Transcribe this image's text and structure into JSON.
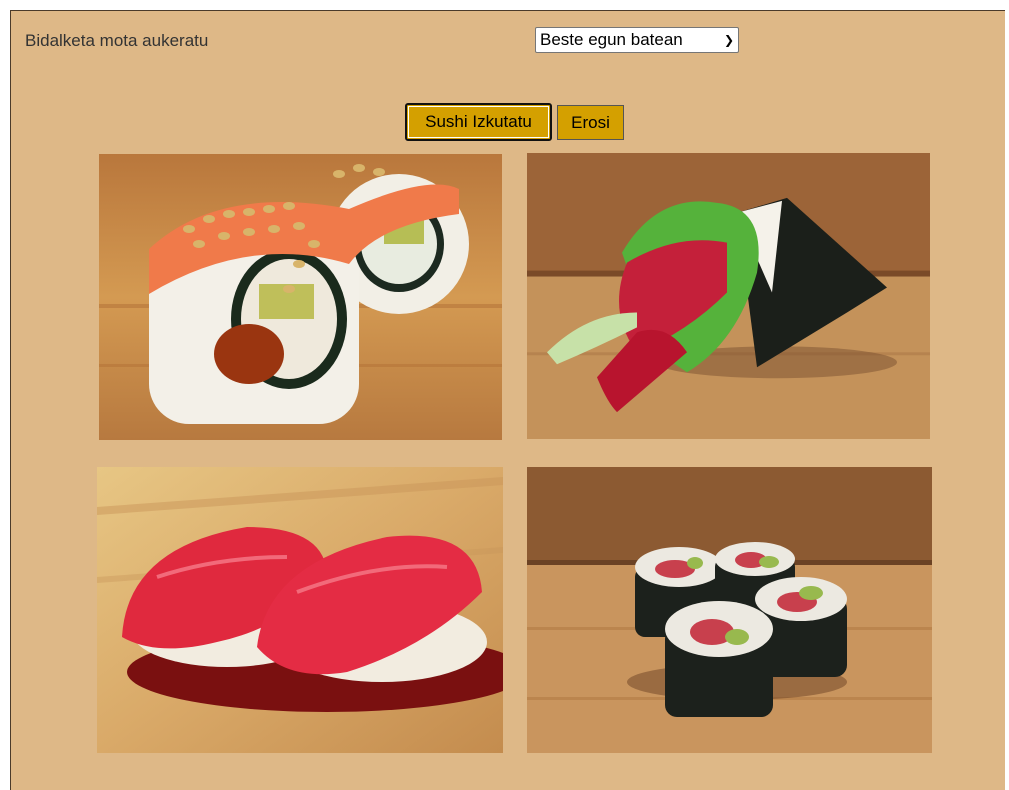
{
  "shipping": {
    "label": "Bidalketa mota aukeratu",
    "selected": "Beste egun batean",
    "chevron": "▾"
  },
  "buttons": {
    "hide_label": "Sushi Izkutatu",
    "buy_label": "Erosi"
  },
  "images": [
    {
      "name": "sushi-roll-salmon-sesame"
    },
    {
      "name": "temaki-tuna-hand-roll"
    },
    {
      "name": "tuna-nigiri"
    },
    {
      "name": "tuna-maki-rolls"
    }
  ]
}
